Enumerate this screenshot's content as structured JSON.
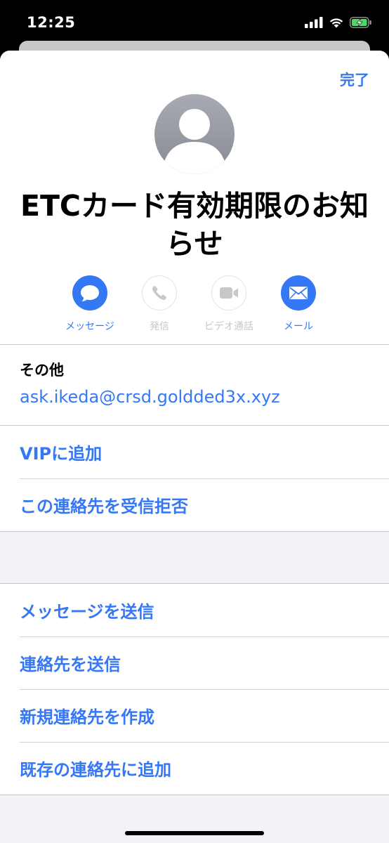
{
  "status_bar": {
    "time": "12:25",
    "icons": [
      "signal-icon",
      "wifi-icon",
      "battery-charging-icon"
    ]
  },
  "header": {
    "done_label": "完了"
  },
  "contact": {
    "name": "ETCカード有効期限のお知らせ"
  },
  "actions": [
    {
      "label": "メッセージ",
      "icon": "message-icon",
      "enabled": true
    },
    {
      "label": "発信",
      "icon": "phone-icon",
      "enabled": false
    },
    {
      "label": "ビデオ通話",
      "icon": "video-icon",
      "enabled": false
    },
    {
      "label": "メール",
      "icon": "mail-icon",
      "enabled": true
    }
  ],
  "email_field": {
    "label": "その他",
    "value": "ask.ikeda@crsd.goldded3x.xyz"
  },
  "group1": [
    "VIPに追加",
    "この連絡先を受信拒否"
  ],
  "group2": [
    "メッセージを送信",
    "連絡先を送信",
    "新規連絡先を作成",
    "既存の連絡先に追加"
  ],
  "colors": {
    "accent": "#3478f6",
    "disabled": "#c7c7cc",
    "background": "#f2f2f7"
  }
}
